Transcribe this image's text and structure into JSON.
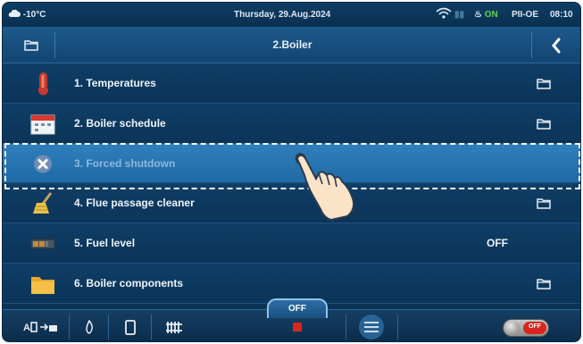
{
  "status_bar": {
    "temperature": "-10°C",
    "date": "Thursday, 29.Aug.2024",
    "on_badge": "ON",
    "device": "PII-OE",
    "time": "08:10"
  },
  "header": {
    "title": "2.Boiler"
  },
  "menu": {
    "items": [
      {
        "label": "1. Temperatures",
        "icon": "thermometer-icon",
        "has_folder": true,
        "value": ""
      },
      {
        "label": "2. Boiler schedule",
        "icon": "calendar-icon",
        "has_folder": true,
        "value": ""
      },
      {
        "label": "3. Forced shutdown",
        "icon": "shutdown-x-icon",
        "has_folder": false,
        "value": "",
        "selected": true
      },
      {
        "label": "4. Flue passage cleaner",
        "icon": "broom-icon",
        "has_folder": true,
        "value": ""
      },
      {
        "label": "5. Fuel level",
        "icon": "fuel-level-icon",
        "has_folder": false,
        "value": "OFF"
      },
      {
        "label": "6. Boiler components",
        "icon": "folder-icon",
        "has_folder": true,
        "value": ""
      }
    ]
  },
  "bottom_bar": {
    "mode_tab": "OFF",
    "toggle_label": "OFF"
  },
  "colors": {
    "background": "#0c3354",
    "header": "#1d5a8c",
    "selected_row": "#2f7fbc",
    "stop_red": "#d9261c",
    "on_green": "#5fd35a"
  }
}
